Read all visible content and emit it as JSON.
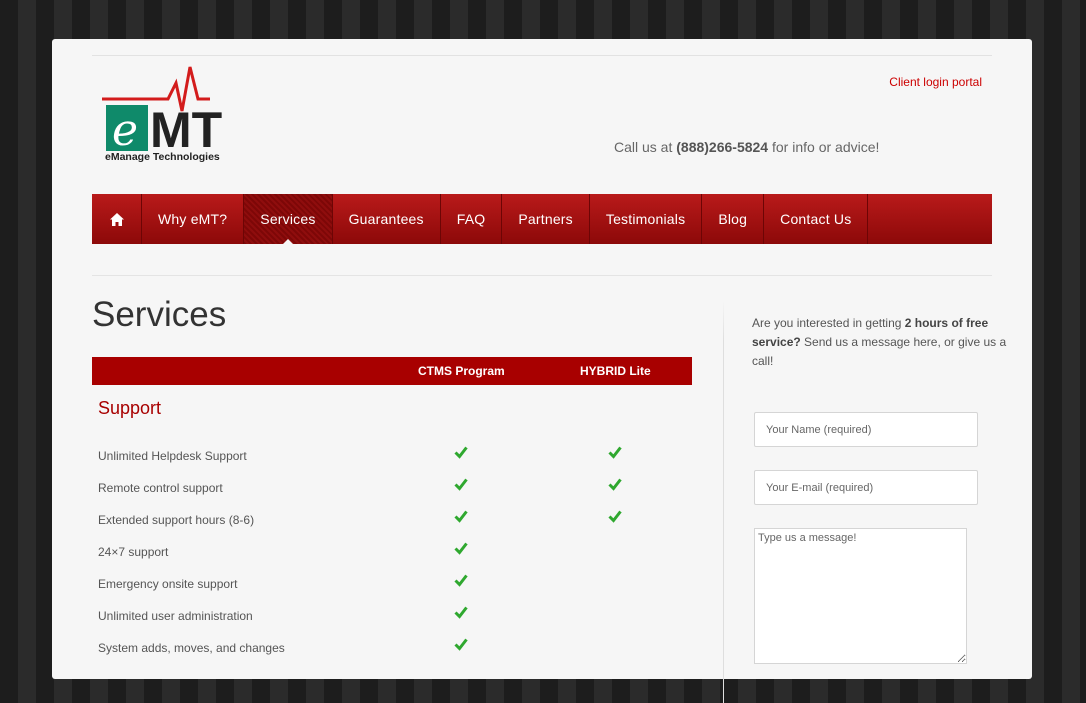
{
  "header": {
    "logo_text": "MT",
    "logo_letter": "e",
    "logo_tagline": "eManage Technologies",
    "client_login": "Client login portal",
    "call_prefix": "Call us at ",
    "call_number": "(888)266-5824",
    "call_suffix": " for info or advice!"
  },
  "nav": {
    "items": [
      {
        "label": "Why eMT?"
      },
      {
        "label": "Services"
      },
      {
        "label": "Guarantees"
      },
      {
        "label": "FAQ"
      },
      {
        "label": "Partners"
      },
      {
        "label": "Testimonials"
      },
      {
        "label": "Blog"
      },
      {
        "label": "Contact Us"
      }
    ],
    "home_icon": "home-icon"
  },
  "main": {
    "title": "Services",
    "columns": [
      "CTMS Program",
      "HYBRID Lite"
    ],
    "section": "Support",
    "rows": [
      {
        "label": "Unlimited Helpdesk Support",
        "ctms": true,
        "hybrid": true
      },
      {
        "label": "Remote control support",
        "ctms": true,
        "hybrid": true
      },
      {
        "label": "Extended support hours (8-6)",
        "ctms": true,
        "hybrid": true
      },
      {
        "label": "24×7 support",
        "ctms": true,
        "hybrid": false
      },
      {
        "label": "Emergency onsite support",
        "ctms": true,
        "hybrid": false
      },
      {
        "label": "Unlimited user administration",
        "ctms": true,
        "hybrid": false
      },
      {
        "label": "System adds, moves, and changes",
        "ctms": true,
        "hybrid": false
      }
    ]
  },
  "sidebar": {
    "intro_pre": "Are you interested in getting ",
    "intro_bold": "2 hours of free service?",
    "intro_post": " Send us a message here, or give us a call!",
    "name_placeholder": "Your Name (required)",
    "email_placeholder": "Your E-mail (required)",
    "message_placeholder": "Type us a message!"
  },
  "colors": {
    "accent": "#a80000",
    "check": "#2fa82f"
  }
}
